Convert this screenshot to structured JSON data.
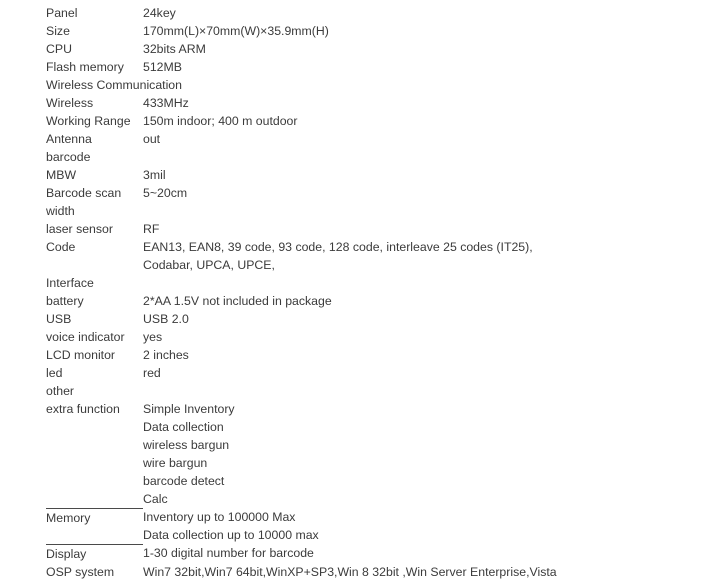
{
  "document": {
    "type": "product-specification-table",
    "text_color": "#3b3b3b",
    "background_color": "#ffffff",
    "rule_color": "#4a4a4a"
  },
  "rows": [
    {
      "label": "Panel",
      "value": "24key"
    },
    {
      "label": "Size",
      "value": "170mm(L)×70mm(W)×35.9mm(H)"
    },
    {
      "label": "CPU",
      "value": "32bits ARM"
    },
    {
      "label": "Flash memory",
      "value": "512MB"
    },
    {
      "label": "Wireless Communication",
      "value": ""
    },
    {
      "label": "Wireless",
      "value": "433MHz"
    },
    {
      "label": "Working Range",
      "value": "150m indoor; 400 m outdoor"
    },
    {
      "label": "Antenna",
      "value": "out"
    },
    {
      "label": "barcode",
      "value": ""
    },
    {
      "label": "MBW",
      "value": "3mil"
    },
    {
      "label": "Barcode scan width",
      "value": "5~20cm"
    },
    {
      "label": "laser sensor",
      "value": "RF"
    },
    {
      "label": "Code",
      "value": "EAN13, EAN8, 39 code, 93 code, 128 code, interleave 25 codes (IT25), Codabar, UPCA, UPCE,"
    },
    {
      "label": "Interface",
      "value": ""
    },
    {
      "label": "battery",
      "value": "2*AA 1.5V not included in package"
    },
    {
      "label": "USB",
      "value": "USB 2.0"
    },
    {
      "label": "voice indicator",
      "value": "yes"
    },
    {
      "label": "LCD monitor",
      "value": "2 inches"
    },
    {
      "label": "led",
      "value": "red"
    },
    {
      "label": "other",
      "value": ""
    }
  ],
  "code_row": {
    "line1": "EAN13, EAN8, 39 code, 93 code, 128 code, interleave 25 codes (IT25),",
    "line2": "Codabar, UPCA, UPCE,"
  },
  "barcode_scan_width": {
    "line1": "Barcode scan",
    "line2": "width"
  },
  "extra_function": {
    "label": "extra function",
    "items": [
      "Simple Inventory",
      "Data collection",
      "wireless bargun",
      "wire bargun",
      "barcode detect",
      "Calc"
    ]
  },
  "memory": {
    "label": "Memory",
    "items": [
      "Inventory up to 100000 Max",
      "Data collection up to 10000 max"
    ]
  },
  "display": {
    "label": "Display",
    "value": "1-30 digital number for barcode"
  },
  "osp_system": {
    "label": "OSP system",
    "value": "Win7 32bit,Win7 64bit,WinXP+SP3,Win 8 32bit ,Win Server Enterprise,Vista"
  }
}
